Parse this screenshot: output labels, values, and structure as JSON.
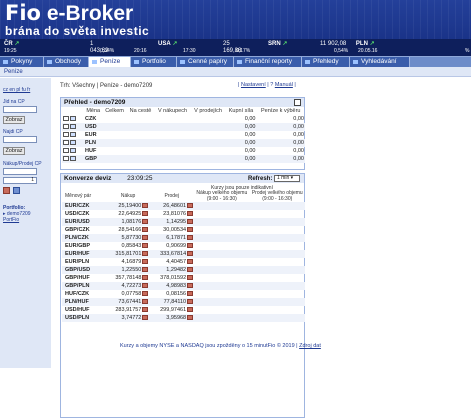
{
  "brand": {
    "name_part1": "Fio",
    "name_part2": "e-Broker",
    "slogan": "brána do světa investic"
  },
  "ticker": [
    {
      "name": "ČR",
      "value": "1 043,62",
      "change": "19:25",
      "pct": "0,34%",
      "time": "20:16"
    },
    {
      "name": "USA",
      "value": "25 169,88",
      "change": "",
      "pct": "0,17%",
      "time": "17:30"
    },
    {
      "name": "SRN",
      "value": "",
      "change": "",
      "pct": "",
      "time": ""
    },
    {
      "name": "PLN",
      "value": "11 902,08",
      "change": "",
      "pct": "0,54%",
      "time": "20.05.16"
    }
  ],
  "nav": [
    "Pokyny",
    "Obchody",
    "Peníze",
    "Portfolio",
    "Cenné papíry",
    "Finanční reporty",
    "Přehledy",
    "Vyhledávání"
  ],
  "subnav": {
    "tab": "Peníze"
  },
  "sidebar": {
    "links": "cz en pl fu fr",
    "label_isin": "Jid na CP",
    "btn_show1": "Zobraz",
    "label_find": "Najdi CP",
    "btn_show2": "Zobraz",
    "label_buysell": "Nákup/Prodej CP",
    "qty": "1",
    "portfolio_label": "Portfolio:",
    "portfolio_item": "demo7209",
    "portfolio_link": "PortFio"
  },
  "main": {
    "breadcrumb": "Trh: Všechny | Peníze - demo7209",
    "link_settings": "Nastavení",
    "link_manual": "Manuál"
  },
  "balances": {
    "title": "Přehled - demo7209",
    "headers": [
      "Měna",
      "Celkem",
      "Na cestě",
      "V nákupech",
      "V prodejích",
      "Kupní síla",
      "Peníze k výběru"
    ],
    "rows": [
      {
        "currency": "CZK",
        "buying_power": "0,00",
        "withdraw": "0,00"
      },
      {
        "currency": "USD",
        "buying_power": "0,00",
        "withdraw": "0,00"
      },
      {
        "currency": "EUR",
        "buying_power": "0,00",
        "withdraw": "0,00"
      },
      {
        "currency": "PLN",
        "buying_power": "0,00",
        "withdraw": "0,00"
      },
      {
        "currency": "HUF",
        "buying_power": "0,00",
        "withdraw": "0,00"
      },
      {
        "currency": "GBP",
        "buying_power": "0,00",
        "withdraw": "0,00"
      }
    ]
  },
  "fx": {
    "title": "Konverze deviz",
    "time": "23:09:25",
    "refresh_label": "Refresh:",
    "refresh_value": "1 min",
    "note": "Kurzy jsou pouze indikativní",
    "headers": {
      "pair": "Měnový pár",
      "buy": "Nákup",
      "sell": "Prodej",
      "buy_large": "Nákup velkého objemu (9:00 - 16:30)",
      "sell_large": "Prodej velkého objemu (9:00 - 16:30)"
    },
    "rows": [
      {
        "pair": "EUR/CZK",
        "buy": "25,19400",
        "sell": "26,48601"
      },
      {
        "pair": "USD/CZK",
        "buy": "22,64925",
        "sell": "23,81076"
      },
      {
        "pair": "EUR/USD",
        "buy": "1,08176",
        "sell": "1,14295"
      },
      {
        "pair": "GBP/CZK",
        "buy": "28,54166",
        "sell": "30,00534"
      },
      {
        "pair": "PLN/CZK",
        "buy": "5,87730",
        "sell": "6,17871"
      },
      {
        "pair": "EUR/GBP",
        "buy": "0,85843",
        "sell": "0,90699"
      },
      {
        "pair": "EUR/HUF",
        "buy": "315,81701",
        "sell": "333,67814"
      },
      {
        "pair": "EUR/PLN",
        "buy": "4,16879",
        "sell": "4,40457"
      },
      {
        "pair": "GBP/USD",
        "buy": "1,22550",
        "sell": "1,29482"
      },
      {
        "pair": "GBP/HUF",
        "buy": "357,78148",
        "sell": "378,01592"
      },
      {
        "pair": "GBP/PLN",
        "buy": "4,72273",
        "sell": "4,98983"
      },
      {
        "pair": "HUF/CZK",
        "buy": "0,07758",
        "sell": "0,08156"
      },
      {
        "pair": "PLN/HUF",
        "buy": "73,67441",
        "sell": "77,84110"
      },
      {
        "pair": "USD/HUF",
        "buy": "283,91757",
        "sell": "299,97461"
      },
      {
        "pair": "USD/PLN",
        "buy": "3,74772",
        "sell": "3,95968"
      }
    ]
  },
  "footer": {
    "text": "Kurzy a objemy NYSE a NASDAQ jsou zpožděny o 15 minut",
    "copyright": "Fio © 2019 |",
    "link_source": "Zdroj dat"
  }
}
